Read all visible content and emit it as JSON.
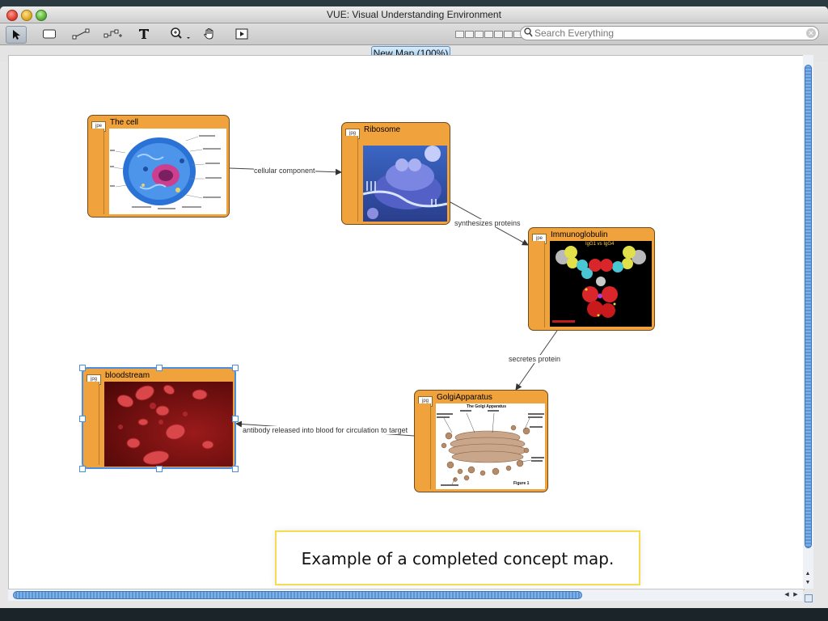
{
  "window": {
    "title": "VUE: Visual Understanding Environment"
  },
  "toolbar": {
    "search_placeholder": "Search Everything",
    "tools": [
      "selection-arrow-icon",
      "node-rectangle-icon",
      "link-tool-icon",
      "link-curve-icon",
      "text-tool-icon",
      "zoom-icon",
      "pan-hand-icon",
      "presentation-play-icon"
    ]
  },
  "tab": {
    "label": "New Map (100%)"
  },
  "nodes": {
    "cell": {
      "label": "The cell",
      "badge": "jpe"
    },
    "ribosome": {
      "label": "Ribosome",
      "badge": "jpg"
    },
    "immunoglobulin": {
      "label": "Immunoglobulin",
      "badge": "jpe",
      "inner_label": "IgG1 vs IgG4"
    },
    "golgi": {
      "label": "GolgiApparatus",
      "badge": "jpg",
      "inner_title": "The Golgi Apparatus",
      "figure": "Figure 1"
    },
    "bloodstream": {
      "label": "bloodstream",
      "badge": "jpg"
    }
  },
  "links": {
    "l1": "cellular component",
    "l2": "synthesizes proteins",
    "l3": "secretes protein",
    "l4": "antibody released into blood for circulation to target"
  },
  "caption": {
    "text": "Example of a completed concept map."
  },
  "colors": {
    "node_fill": "#f0a33c",
    "selection": "#4c8fe0",
    "caption_border": "#f3de53"
  }
}
